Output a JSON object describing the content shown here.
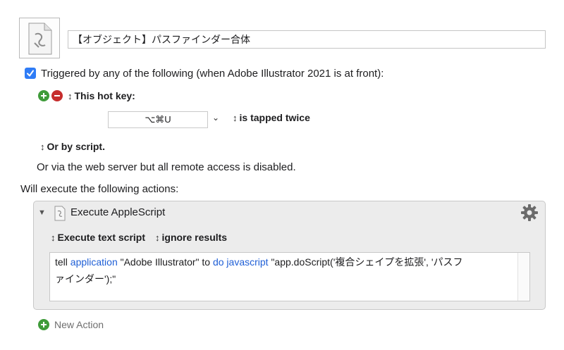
{
  "macro": {
    "icon": "applescript-doc-icon",
    "name": "【オブジェクト】パスファインダー合体"
  },
  "trigger": {
    "checked": true,
    "text": "Triggered by any of the following (when Adobe Illustrator 2021 is at front):"
  },
  "hotkey": {
    "type_label": "This hot key:",
    "key": "⌥⌘U",
    "mode_label": "is tapped twice"
  },
  "script_trigger_label": "Or by script.",
  "webserver_text": "Or via the web server but all remote access is disabled.",
  "actions_heading": "Will execute the following actions:",
  "action": {
    "title": "Execute AppleScript",
    "source_label": "Execute text script",
    "results_label": "ignore results",
    "script": {
      "t1": "tell ",
      "k1": "application",
      "t2": " \"Adobe Illustrator\" to ",
      "k2": "do javascript",
      "t3": " \"app.doScript('複合シェイプを拡張', 'パスフ",
      "t4": "ァインダー');\""
    }
  },
  "new_action_label": "New Action",
  "colors": {
    "accent": "#2f7cf6",
    "plus": "#3f9b3a",
    "minus": "#c62d2d",
    "keyword": "#1f5fd6"
  }
}
